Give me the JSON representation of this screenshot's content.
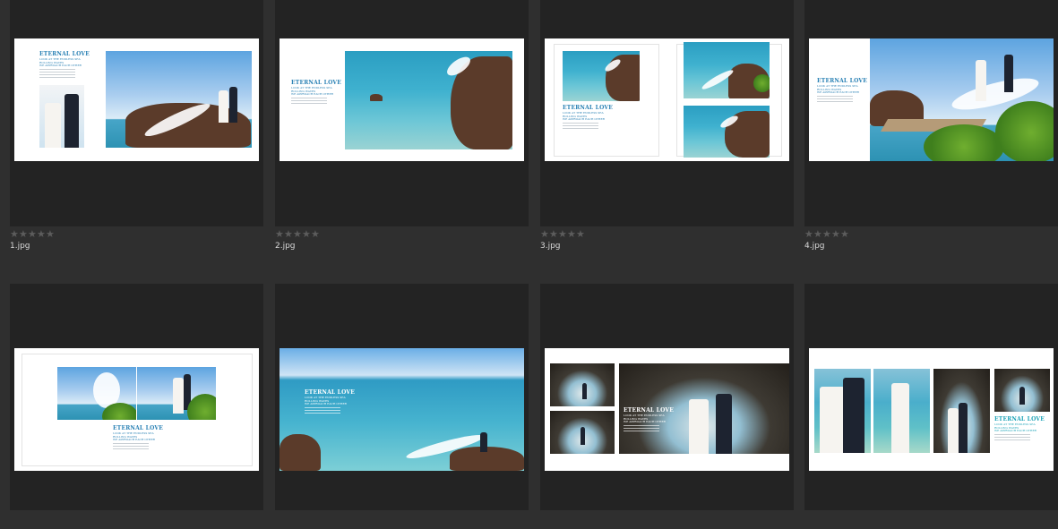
{
  "items": [
    {
      "filename": "1.jpg",
      "rating": 0,
      "title": "ETERNAL LOVE",
      "subtitle": "LOOK AT THE ENDLESS SEA\nROLLING WAVES\nWE APPROACH EACH OTHER"
    },
    {
      "filename": "2.jpg",
      "rating": 0,
      "title": "ETERNAL LOVE",
      "subtitle": "LOOK AT THE ENDLESS SEA\nROLLING WAVES\nWE APPROACH EACH OTHER"
    },
    {
      "filename": "3.jpg",
      "rating": 0,
      "title": "ETERNAL LOVE",
      "subtitle": "LOOK AT THE ENDLESS SEA\nROLLING WAVES\nWE APPROACH EACH OTHER"
    },
    {
      "filename": "4.jpg",
      "rating": 0,
      "title": "ETERNAL LOVE",
      "subtitle": "LOOK AT THE ENDLESS SEA\nROLLING WAVES\nWE APPROACH EACH OTHER"
    },
    {
      "filename": "",
      "rating": null,
      "title": "ETERNAL LOVE",
      "subtitle": "LOOK AT THE ENDLESS SEA\nROLLING WAVES\nWE APPROACH EACH OTHER"
    },
    {
      "filename": "",
      "rating": null,
      "title": "ETERNAL LOVE",
      "subtitle": "LOOK AT THE ENDLESS SEA\nROLLING WAVES\nWE APPROACH EACH OTHER"
    },
    {
      "filename": "",
      "rating": null,
      "title": "ETERNAL LOVE",
      "subtitle": "LOOK AT THE ENDLESS SEA\nROLLING WAVES\nWE APPROACH EACH OTHER"
    },
    {
      "filename": "",
      "rating": null,
      "title": "ETERNAL LOVE",
      "subtitle": "LOOK AT THE ENDLESS SEA\nROLLING WAVES\nWE APPROACH EACH OTHER"
    }
  ],
  "ui": {
    "star_glyph": "★",
    "star_count": 5
  },
  "colors": {
    "background": "#2f2f2f",
    "tile": "#232323",
    "star": "#5c5c5c",
    "accent_text": "#2b82b5"
  }
}
